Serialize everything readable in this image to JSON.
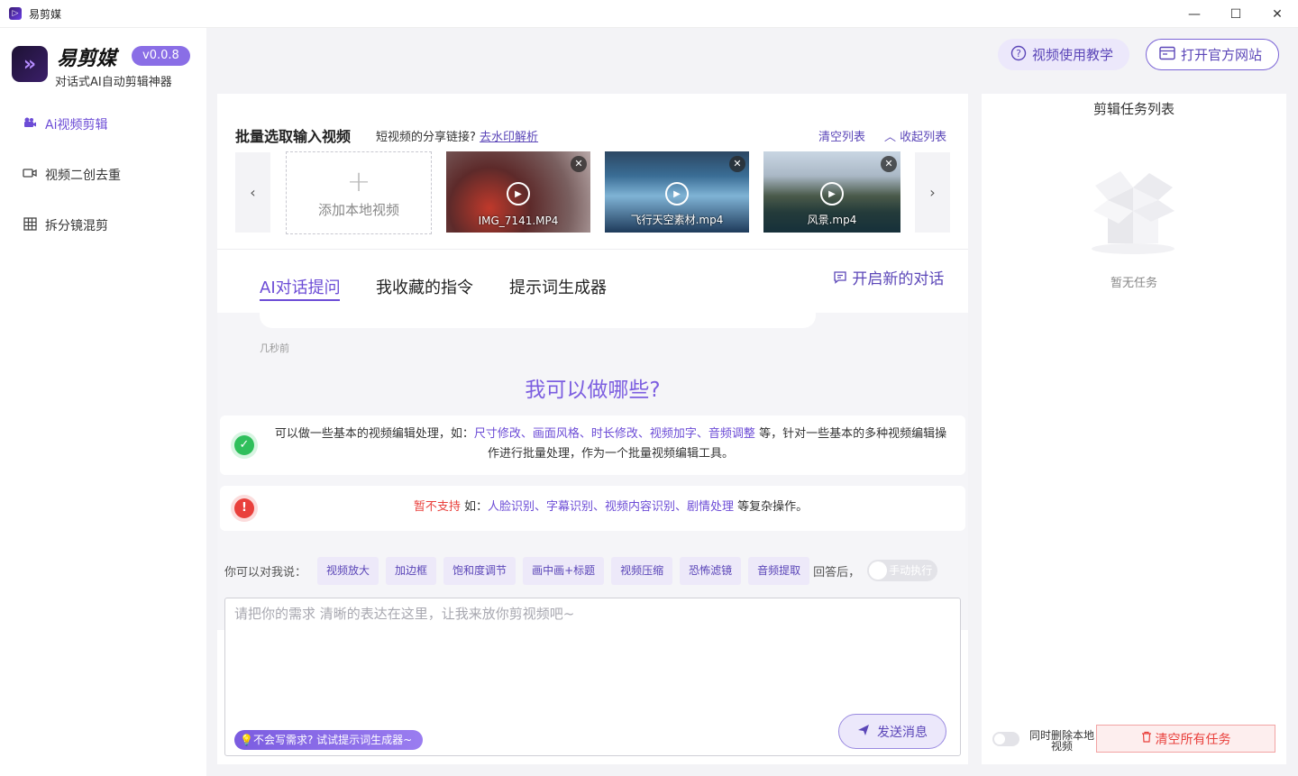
{
  "window": {
    "title": "易剪媒",
    "controls": {
      "minimize": "—",
      "maximize": "☐",
      "close": "✕"
    }
  },
  "brand": {
    "name": "易剪媒",
    "version": "v0.0.8",
    "tagline": "对话式AI自动剪辑神器",
    "logo_icon": "play-chevron-logo"
  },
  "sidebar": {
    "items": [
      {
        "label": "Ai视频剪辑",
        "icon": "camera-icon",
        "active": true
      },
      {
        "label": "视频二创去重",
        "icon": "video-camera-icon",
        "active": false
      },
      {
        "label": "拆分镜混剪",
        "icon": "grid-icon",
        "active": false
      }
    ]
  },
  "header": {
    "tutorial_label": "视频使用教学",
    "website_label": "打开官方网站"
  },
  "upload": {
    "title": "批量选取输入视频",
    "share_prompt": "短视频的分享链接?",
    "share_link": "去水印解析",
    "clear_list": "清空列表",
    "collapse_list": "收起列表",
    "add_local": "添加本地视频",
    "videos": [
      {
        "name": "IMG_7141.MP4"
      },
      {
        "name": "飞行天空素材.mp4"
      },
      {
        "name": "风景.mp4"
      }
    ]
  },
  "tabs": {
    "items": [
      "AI对话提问",
      "我收藏的指令",
      "提示词生成器"
    ],
    "active_index": 0,
    "new_chat": "开启新的对话"
  },
  "chat": {
    "timestamp": "几秒前",
    "can_do_title": "我可以做哪些?",
    "can_do": {
      "prefix": "可以做一些基本的视频编辑处理，如：",
      "features": "尺寸修改、画面风格、时长修改、视频加字、音频调整",
      "suffix": " 等，针对一些基本的多种视频编辑操作进行批量处理，作为一个批量视频编辑工具。"
    },
    "cannot_do": {
      "label": "暂不支持",
      "prefix": " 如：",
      "features": "人脸识别、字幕识别、视频内容识别、剧情处理",
      "suffix": " 等复杂操作。"
    }
  },
  "suggestions": {
    "label": "你可以对我说：",
    "chips": [
      "视频放大",
      "加边框",
      "饱和度调节",
      "画中画+标题",
      "视频压缩",
      "恐怖滤镜",
      "音频提取"
    ],
    "after_label": "回答后，",
    "manual_toggle_label": "手动执行"
  },
  "input": {
    "placeholder": "请把你的需求 清晰的表达在这里，让我来放你剪视频吧~",
    "hint": "不会写需求? 试试提示词生成器~",
    "send_label": "发送消息"
  },
  "tasks": {
    "title": "剪辑任务列表",
    "empty_text": "暂无任务",
    "delete_local_label": "同时删除本地视频",
    "clear_all_label": "清空所有任务"
  },
  "colors": {
    "accent": "#6c4cd6",
    "success": "#2fbf5b",
    "danger": "#e9403c",
    "chip_bg": "#ede9f9"
  }
}
